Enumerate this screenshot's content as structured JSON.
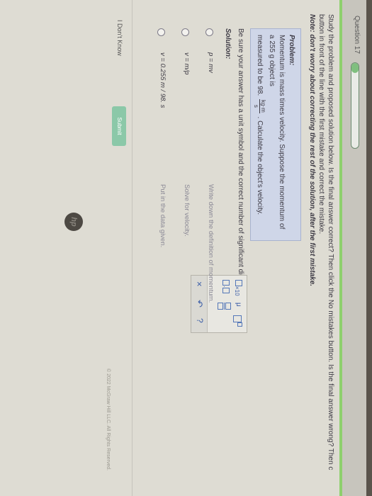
{
  "header": {
    "question_label": "Question 17",
    "progress_fraction": 0.12
  },
  "instructions": {
    "line1": "Study the problem and proposed solution below. Is the final answer correct? Then click the No mistakes button. Is the final answer wrong? Then c",
    "line2": "button in front of the line with the first mistake and correct the mistake.",
    "line3": "Note: don't worry about correcting the rest of the solution, after the first mistake."
  },
  "problem": {
    "title": "Problem:",
    "text1": "Momentum is mass times velocity. Suppose the momentum of a 255 g object is",
    "text2a": "measured to be 98.",
    "unit_num": "kg·m",
    "unit_den": "s",
    "text2b": ". Calculate the object's velocity."
  },
  "sure_text": "Be sure your answer has a unit symbol and the correct number of significant digits.",
  "solution_title": "Solution:",
  "steps": [
    {
      "math": "p = mv",
      "desc": "Write down the definition of momentum."
    },
    {
      "math": "v = m/p",
      "desc": "Solve for velocity."
    },
    {
      "math": "v = 0.255 m / 98. s",
      "desc": "Put in the data given."
    }
  ],
  "tools": {
    "x10": "×10",
    "mu": "μ",
    "dot": "·",
    "clear": "×",
    "undo": "↶",
    "help": "?"
  },
  "buttons": {
    "dont_know": "I Don't Know",
    "submit": "Submit"
  },
  "copyright": "© 2022 McGraw Hill LLC. All Rights Reserved.",
  "logo": "hp",
  "colors": {
    "accent_green": "#8ed06d",
    "problem_bg": "#cfd6e8",
    "tool_blue": "#3d5fa8"
  }
}
